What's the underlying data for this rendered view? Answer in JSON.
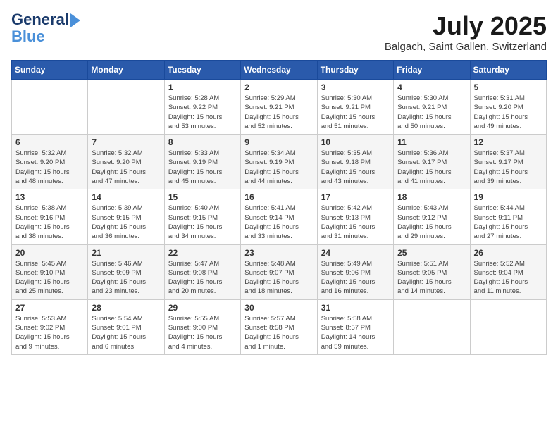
{
  "header": {
    "logo_line1": "General",
    "logo_line2": "Blue",
    "month_title": "July 2025",
    "location": "Balgach, Saint Gallen, Switzerland"
  },
  "weekdays": [
    "Sunday",
    "Monday",
    "Tuesday",
    "Wednesday",
    "Thursday",
    "Friday",
    "Saturday"
  ],
  "weeks": [
    [
      {
        "day": "",
        "info": ""
      },
      {
        "day": "",
        "info": ""
      },
      {
        "day": "1",
        "info": "Sunrise: 5:28 AM\nSunset: 9:22 PM\nDaylight: 15 hours\nand 53 minutes."
      },
      {
        "day": "2",
        "info": "Sunrise: 5:29 AM\nSunset: 9:21 PM\nDaylight: 15 hours\nand 52 minutes."
      },
      {
        "day": "3",
        "info": "Sunrise: 5:30 AM\nSunset: 9:21 PM\nDaylight: 15 hours\nand 51 minutes."
      },
      {
        "day": "4",
        "info": "Sunrise: 5:30 AM\nSunset: 9:21 PM\nDaylight: 15 hours\nand 50 minutes."
      },
      {
        "day": "5",
        "info": "Sunrise: 5:31 AM\nSunset: 9:20 PM\nDaylight: 15 hours\nand 49 minutes."
      }
    ],
    [
      {
        "day": "6",
        "info": "Sunrise: 5:32 AM\nSunset: 9:20 PM\nDaylight: 15 hours\nand 48 minutes."
      },
      {
        "day": "7",
        "info": "Sunrise: 5:32 AM\nSunset: 9:20 PM\nDaylight: 15 hours\nand 47 minutes."
      },
      {
        "day": "8",
        "info": "Sunrise: 5:33 AM\nSunset: 9:19 PM\nDaylight: 15 hours\nand 45 minutes."
      },
      {
        "day": "9",
        "info": "Sunrise: 5:34 AM\nSunset: 9:19 PM\nDaylight: 15 hours\nand 44 minutes."
      },
      {
        "day": "10",
        "info": "Sunrise: 5:35 AM\nSunset: 9:18 PM\nDaylight: 15 hours\nand 43 minutes."
      },
      {
        "day": "11",
        "info": "Sunrise: 5:36 AM\nSunset: 9:17 PM\nDaylight: 15 hours\nand 41 minutes."
      },
      {
        "day": "12",
        "info": "Sunrise: 5:37 AM\nSunset: 9:17 PM\nDaylight: 15 hours\nand 39 minutes."
      }
    ],
    [
      {
        "day": "13",
        "info": "Sunrise: 5:38 AM\nSunset: 9:16 PM\nDaylight: 15 hours\nand 38 minutes."
      },
      {
        "day": "14",
        "info": "Sunrise: 5:39 AM\nSunset: 9:15 PM\nDaylight: 15 hours\nand 36 minutes."
      },
      {
        "day": "15",
        "info": "Sunrise: 5:40 AM\nSunset: 9:15 PM\nDaylight: 15 hours\nand 34 minutes."
      },
      {
        "day": "16",
        "info": "Sunrise: 5:41 AM\nSunset: 9:14 PM\nDaylight: 15 hours\nand 33 minutes."
      },
      {
        "day": "17",
        "info": "Sunrise: 5:42 AM\nSunset: 9:13 PM\nDaylight: 15 hours\nand 31 minutes."
      },
      {
        "day": "18",
        "info": "Sunrise: 5:43 AM\nSunset: 9:12 PM\nDaylight: 15 hours\nand 29 minutes."
      },
      {
        "day": "19",
        "info": "Sunrise: 5:44 AM\nSunset: 9:11 PM\nDaylight: 15 hours\nand 27 minutes."
      }
    ],
    [
      {
        "day": "20",
        "info": "Sunrise: 5:45 AM\nSunset: 9:10 PM\nDaylight: 15 hours\nand 25 minutes."
      },
      {
        "day": "21",
        "info": "Sunrise: 5:46 AM\nSunset: 9:09 PM\nDaylight: 15 hours\nand 23 minutes."
      },
      {
        "day": "22",
        "info": "Sunrise: 5:47 AM\nSunset: 9:08 PM\nDaylight: 15 hours\nand 20 minutes."
      },
      {
        "day": "23",
        "info": "Sunrise: 5:48 AM\nSunset: 9:07 PM\nDaylight: 15 hours\nand 18 minutes."
      },
      {
        "day": "24",
        "info": "Sunrise: 5:49 AM\nSunset: 9:06 PM\nDaylight: 15 hours\nand 16 minutes."
      },
      {
        "day": "25",
        "info": "Sunrise: 5:51 AM\nSunset: 9:05 PM\nDaylight: 15 hours\nand 14 minutes."
      },
      {
        "day": "26",
        "info": "Sunrise: 5:52 AM\nSunset: 9:04 PM\nDaylight: 15 hours\nand 11 minutes."
      }
    ],
    [
      {
        "day": "27",
        "info": "Sunrise: 5:53 AM\nSunset: 9:02 PM\nDaylight: 15 hours\nand 9 minutes."
      },
      {
        "day": "28",
        "info": "Sunrise: 5:54 AM\nSunset: 9:01 PM\nDaylight: 15 hours\nand 6 minutes."
      },
      {
        "day": "29",
        "info": "Sunrise: 5:55 AM\nSunset: 9:00 PM\nDaylight: 15 hours\nand 4 minutes."
      },
      {
        "day": "30",
        "info": "Sunrise: 5:57 AM\nSunset: 8:58 PM\nDaylight: 15 hours\nand 1 minute."
      },
      {
        "day": "31",
        "info": "Sunrise: 5:58 AM\nSunset: 8:57 PM\nDaylight: 14 hours\nand 59 minutes."
      },
      {
        "day": "",
        "info": ""
      },
      {
        "day": "",
        "info": ""
      }
    ]
  ]
}
